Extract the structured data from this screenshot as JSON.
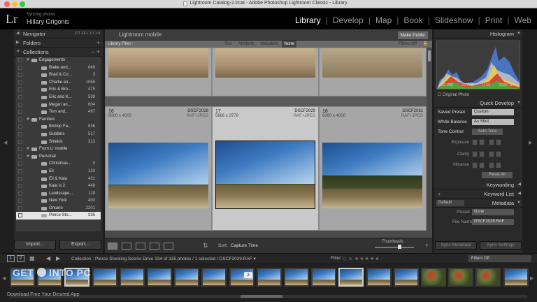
{
  "window": {
    "title": "Lightroom Catalog-2.lrcat - Adobe Photoshop Lightroom Classic - Library"
  },
  "identity": {
    "logo": "Lr",
    "sync_status": "Syncing photos",
    "user_name": "Hillary Grigonis"
  },
  "modules": [
    {
      "label": "Library",
      "active": true
    },
    {
      "label": "Develop"
    },
    {
      "label": "Map"
    },
    {
      "label": "Book"
    },
    {
      "label": "Slideshow"
    },
    {
      "label": "Print"
    },
    {
      "label": "Web"
    }
  ],
  "left_panel": {
    "navigator_label": "Navigator",
    "navigator_controls": "FIT  FILL  1:1  1:4",
    "folders_label": "Folders",
    "collections_label": "Collections",
    "collections_controls": "–  +",
    "collections": [
      {
        "indent": 1,
        "label": "Engagements",
        "count": "",
        "set": true
      },
      {
        "indent": 2,
        "label": "Blake and...",
        "count": "649"
      },
      {
        "indent": 2,
        "label": "Brad & Co...",
        "count": "3"
      },
      {
        "indent": 2,
        "label": "Charlie an...",
        "count": "1058"
      },
      {
        "indent": 2,
        "label": "Eric & Bro...",
        "count": "475"
      },
      {
        "indent": 2,
        "label": "Eric and K...",
        "count": "539"
      },
      {
        "indent": 2,
        "label": "Megan an...",
        "count": "604"
      },
      {
        "indent": 2,
        "label": "Tom and...",
        "count": "497"
      },
      {
        "indent": 1,
        "label": "Families",
        "count": "",
        "set": true
      },
      {
        "indent": 2,
        "label": "Bishop Fa...",
        "count": "836"
      },
      {
        "indent": 2,
        "label": "Gubbins",
        "count": "517"
      },
      {
        "indent": 2,
        "label": "Shields",
        "count": "313"
      },
      {
        "indent": 1,
        "label": "From Lr mobile",
        "count": "",
        "set": true
      },
      {
        "indent": 1,
        "label": "Personal",
        "count": "",
        "set": true
      },
      {
        "indent": 2,
        "label": "Christmas...",
        "count": "0"
      },
      {
        "indent": 2,
        "label": "Eli",
        "count": "123"
      },
      {
        "indent": 2,
        "label": "Eli & Kaia",
        "count": "431"
      },
      {
        "indent": 2,
        "label": "Kaia is 2",
        "count": "448"
      },
      {
        "indent": 2,
        "label": "Landscape...",
        "count": "119"
      },
      {
        "indent": 2,
        "label": "New York",
        "count": "400"
      },
      {
        "indent": 2,
        "label": "Ontario",
        "count": "2201"
      },
      {
        "indent": 2,
        "label": "Pierce Sto...",
        "count": "335",
        "selected": true
      }
    ],
    "import_label": "Import...",
    "export_label": "Export..."
  },
  "center": {
    "header_title": "Lightroom mobile",
    "make_public_label": "Make Public",
    "filter_label": "Library Filter :",
    "filter_options": [
      "Text",
      "Attribute",
      "Metadata",
      "None"
    ],
    "filter_active": "None",
    "filters_off_label": "Filters Off",
    "cells": [
      {
        "index": "16",
        "name": "DSCF2028",
        "type": "RAF+JPEG",
        "dims": "6000 x 4000"
      },
      {
        "index": "17",
        "name": "DSCF2029",
        "type": "RAF+JPEG",
        "dims": "5666 x 3778",
        "selected": true
      },
      {
        "index": "18",
        "name": "DSCF2031",
        "type": "RAF+JPEG",
        "dims": "6000 x 4000"
      }
    ],
    "sort_label": "Sort:",
    "sort_value": "Capture Time",
    "thumbnails_label": "Thumbnails",
    "thumbnails_size": 0.62
  },
  "right_panel": {
    "histogram_label": "Histogram",
    "exif": [
      "ISO 200",
      "23 mm",
      "f / 16",
      "1/250 SEC"
    ],
    "original_photo_label": "Original Photo",
    "quick_develop_label": "Quick Develop",
    "saved_preset_label": "Saved Preset",
    "saved_preset_value": "Custom",
    "white_balance_label": "White Balance",
    "white_balance_value": "As Shot",
    "tone_control_label": "Tone Control",
    "auto_tone_label": "Auto Tone",
    "exposure_label": "Exposure",
    "clarity_label": "Clarity",
    "vibrance_label": "Vibrance",
    "reset_all_label": "Reset All",
    "keywording_label": "Keywording",
    "keyword_list_label": "Keyword List",
    "metadata_preset_value": "Default",
    "metadata_label": "Metadata",
    "preset_label": "Preset",
    "preset_value": "None",
    "file_name_label": "File Name",
    "file_name_value": "DSCF2029.RAF",
    "sync_metadata_label": "Sync Metadata",
    "sync_settings_label": "Sync Settings"
  },
  "filmstrip": {
    "breadcrumb": "Collection : Pierce Stocking Scenic Drive    334 of 335 photos / 1 selected / DSCF2029.RAF ▾",
    "filter_label": "Filter :",
    "filters_off_label": "Filters Off",
    "monitor_buttons": [
      "1",
      "2"
    ],
    "selected_number": "2"
  },
  "watermark": {
    "line1": "GET INTO PC",
    "line2": "Download Free Your Desired App"
  },
  "colors": {
    "accent": "#ffffff",
    "panel": "#2a2a2a",
    "grid": "#5a5a5a"
  }
}
